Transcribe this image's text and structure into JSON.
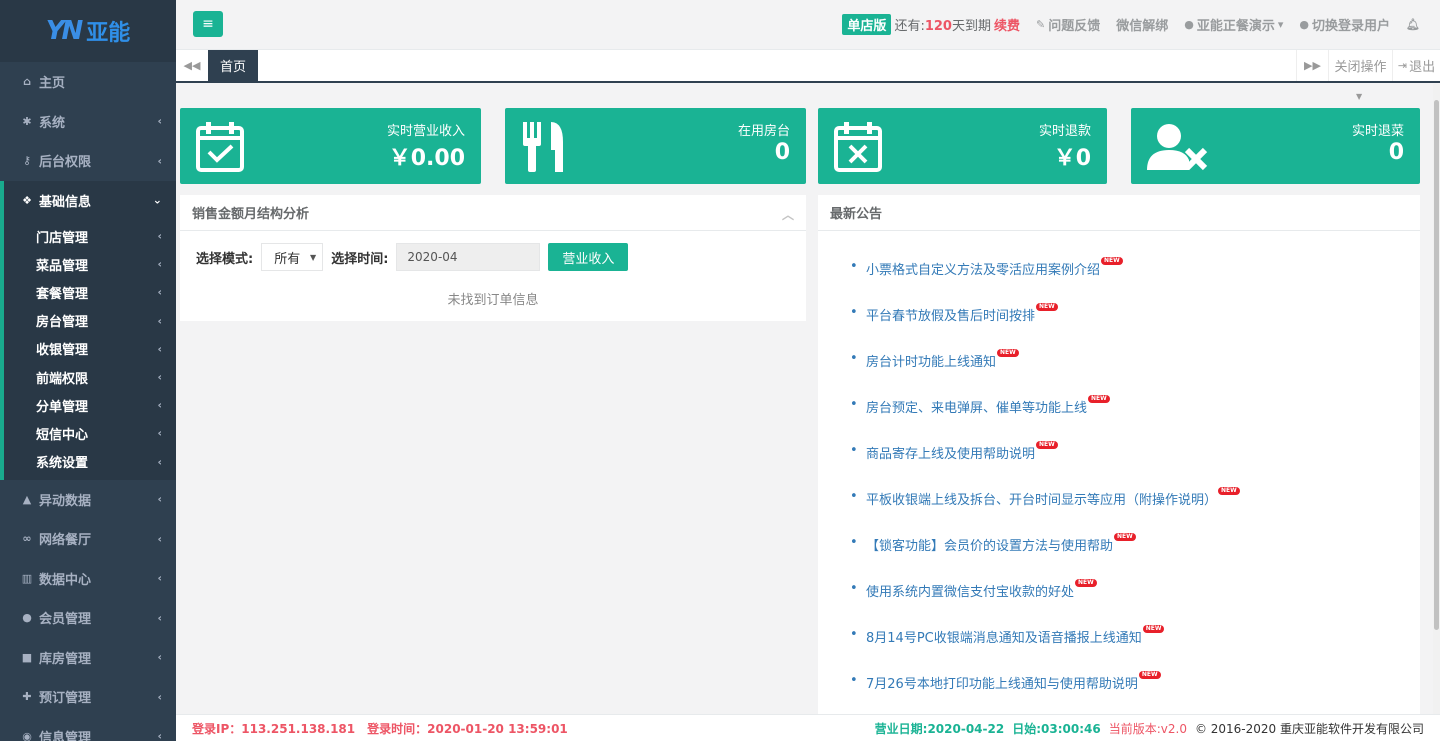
{
  "brand": {
    "logo_mark": "YN",
    "logo_text": "亚能"
  },
  "sidebar": {
    "items": [
      {
        "label": "主页",
        "icon": "home-icon"
      },
      {
        "label": "系统",
        "icon": "gear-icon"
      },
      {
        "label": "后台权限",
        "icon": "key-icon"
      },
      {
        "label": "基础信息",
        "icon": "cubes-icon"
      },
      {
        "label": "异动数据",
        "icon": "warning-icon"
      },
      {
        "label": "网络餐厅",
        "icon": "link-icon"
      },
      {
        "label": "数据中心",
        "icon": "bar-chart-icon"
      },
      {
        "label": "会员管理",
        "icon": "users-icon"
      },
      {
        "label": "库房管理",
        "icon": "truck-icon"
      },
      {
        "label": "预订管理",
        "icon": "user-plus-icon"
      },
      {
        "label": "信息管理",
        "icon": "comments-icon"
      }
    ],
    "sub_items": [
      "门店管理",
      "菜品管理",
      "套餐管理",
      "房台管理",
      "收银管理",
      "前端权限",
      "分单管理",
      "短信中心",
      "系统设置"
    ]
  },
  "topbar": {
    "store_badge": "单店版",
    "expire_prefix": "还有:",
    "expire_days": "120",
    "expire_suffix": "天到期",
    "renew": "续费",
    "feedback": "问题反馈",
    "wechat_unbind": "微信解绑",
    "account": "亚能正餐演示",
    "switch_user": "切换登录用户"
  },
  "tabs": {
    "home": "首页",
    "close_ops": "关闭操作",
    "logout": "退出"
  },
  "cards": [
    {
      "label": "实时营业收入",
      "value": "￥0.00"
    },
    {
      "label": "在用房台",
      "value": "0"
    },
    {
      "label": "实时退款",
      "value": "￥0"
    },
    {
      "label": "实时退菜",
      "value": "0"
    }
  ],
  "sales_panel": {
    "title": "销售金额月结构分析",
    "mode_label": "选择模式:",
    "mode_value": "所有",
    "time_label": "选择时间:",
    "time_value": "2020-04",
    "button": "营业收入",
    "empty": "未找到订单信息"
  },
  "notice_panel": {
    "title": "最新公告",
    "new_tag": "NEW",
    "items": [
      "小票格式自定义方法及零活应用案例介绍",
      "平台春节放假及售后时间按排",
      "房台计时功能上线通知",
      "房台预定、来电弹屏、催单等功能上线",
      "商品寄存上线及使用帮助说明",
      "平板收银端上线及拆台、开台时间显示等应用（附操作说明）",
      "【锁客功能】会员价的设置方法与使用帮助",
      "使用系统内置微信支付宝收款的好处",
      "8月14号PC收银端消息通知及语音播报上线通知",
      "7月26号本地打印功能上线通知与使用帮助说明"
    ]
  },
  "footer": {
    "login_ip": "登录IP：113.251.138.181",
    "login_time": "登录时间：2020-01-20 13:59:01",
    "business_date": "营业日期:2020-04-22",
    "daily": "日始:03:00:46",
    "version": "当前版本:v2.0",
    "copyright": "© 2016-2020 重庆亚能软件开发有限公司"
  },
  "colors": {
    "accent": "#1ab394",
    "sidebar": "#2f4050",
    "danger": "#ed5565",
    "link": "#337ab7"
  }
}
